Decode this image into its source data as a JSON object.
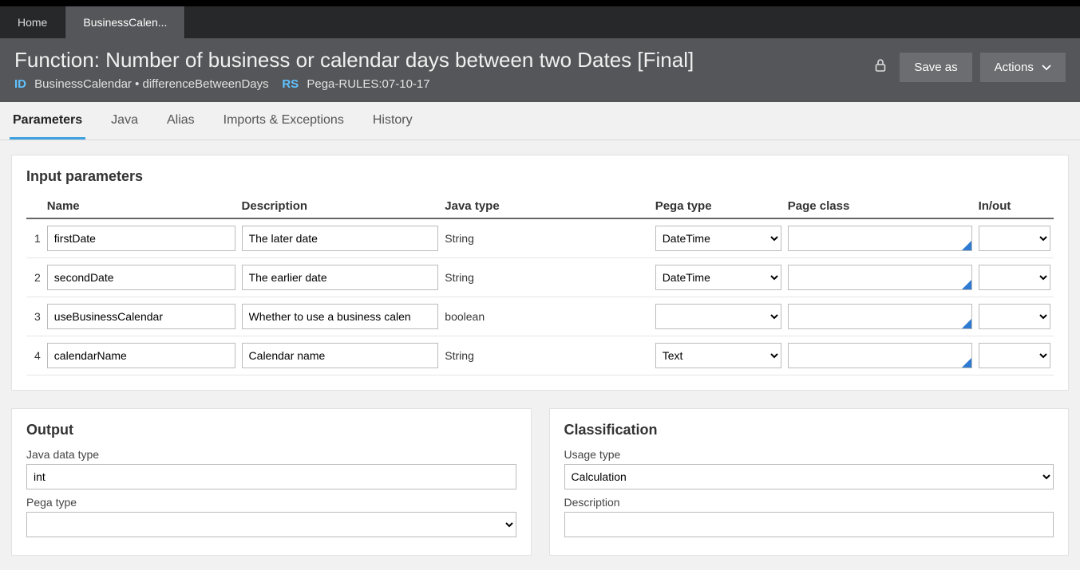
{
  "tabs": {
    "home": "Home",
    "business": "BusinessCalen..."
  },
  "header": {
    "title": "Function: Number of business or calendar days between two Dates [Final]",
    "id_label": "ID",
    "id_value": "BusinessCalendar • differenceBetweenDays",
    "rs_label": "RS",
    "rs_value": "Pega-RULES:07-10-17",
    "save_as": "Save as",
    "actions": "Actions"
  },
  "ruletabs": {
    "parameters": "Parameters",
    "java": "Java",
    "alias": "Alias",
    "imports": "Imports & Exceptions",
    "history": "History"
  },
  "inputparams": {
    "heading": "Input parameters",
    "cols": {
      "name": "Name",
      "desc": "Description",
      "java": "Java type",
      "pega": "Pega type",
      "pc": "Page class",
      "io": "In/out"
    },
    "rows": [
      {
        "idx": "1",
        "name": "firstDate",
        "desc": "The later date",
        "java": "String",
        "pega": "DateTime",
        "pc": "",
        "io": ""
      },
      {
        "idx": "2",
        "name": "secondDate",
        "desc": "The earlier date",
        "java": "String",
        "pega": "DateTime",
        "pc": "",
        "io": ""
      },
      {
        "idx": "3",
        "name": "useBusinessCalendar",
        "desc": "Whether to use a business calen",
        "java": "boolean",
        "pega": "",
        "pc": "",
        "io": ""
      },
      {
        "idx": "4",
        "name": "calendarName",
        "desc": "Calendar name",
        "java": "String",
        "pega": "Text",
        "pc": "",
        "io": ""
      }
    ]
  },
  "output": {
    "heading": "Output",
    "java_label": "Java data type",
    "java_value": "int",
    "pega_label": "Pega type",
    "pega_value": ""
  },
  "classification": {
    "heading": "Classification",
    "usage_label": "Usage type",
    "usage_value": "Calculation",
    "desc_label": "Description",
    "desc_value": ""
  }
}
